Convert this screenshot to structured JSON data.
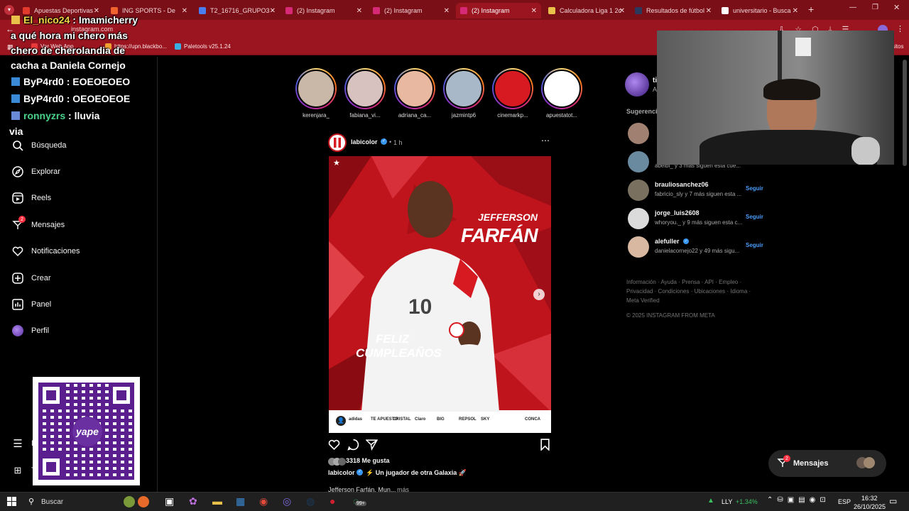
{
  "browser": {
    "tabs": [
      {
        "label": "Apuestas Deportivas",
        "color": "#e23b2e"
      },
      {
        "label": "ING SPORTS - De",
        "color": "#f0622e"
      },
      {
        "label": "T2_16716_GRUPO3 -",
        "color": "#4a7ef0"
      },
      {
        "label": "(2) Instagram",
        "color": "#d62976"
      },
      {
        "label": "(2) Instagram",
        "color": "#d62976"
      },
      {
        "label": "(2) Instagram",
        "color": "#d62976"
      },
      {
        "label": "Calculadora Liga 1 2c",
        "color": "#e8c04a"
      },
      {
        "label": "Resultados de fútbol",
        "color": "#2b3a5c"
      },
      {
        "label": "universitario - Busca",
        "color": "#ffffff"
      }
    ],
    "url": "instagram.com",
    "bookmarks": [
      "Ver Web App",
      "https://upn.blackbo...",
      "Paletools v25.1.24",
      "sitos"
    ]
  },
  "chat": [
    {
      "user": "El_nico24",
      "user_color": "#f5d547",
      "message": "Imamicherry"
    },
    {
      "message": "a qué hora mi chero más"
    },
    {
      "message": "chero de cherolandia de"
    },
    {
      "message": "cacha a Daniela Cornejo"
    },
    {
      "user": "ByP4rd0",
      "user_color": "#ffffff",
      "message": "EOEOEOEO"
    },
    {
      "user": "ByP4rd0",
      "user_color": "#ffffff",
      "message": "OEOEOEOE"
    },
    {
      "user": "ronnyzrs",
      "user_color": "#4ad18a",
      "message": "lluvia"
    },
    {
      "message": "via"
    }
  ],
  "sidebar": {
    "items": [
      {
        "label": "Búsqueda",
        "icon": "search-icon"
      },
      {
        "label": "Explorar",
        "icon": "compass-icon"
      },
      {
        "label": "Reels",
        "icon": "reels-icon"
      },
      {
        "label": "Mensajes",
        "icon": "messenger-icon",
        "badge": "2"
      },
      {
        "label": "Notificaciones",
        "icon": "heart-icon"
      },
      {
        "label": "Crear",
        "icon": "plus-square-icon"
      },
      {
        "label": "Panel",
        "icon": "dashboard-icon"
      },
      {
        "label": "Perfil",
        "icon": "avatar-icon"
      }
    ],
    "more_label": "M",
    "threads_label": "T"
  },
  "stories": [
    {
      "name": "kerenjara_",
      "color": "#c9b7a8"
    },
    {
      "name": "fabiana_vi...",
      "color": "#d8c2c0"
    },
    {
      "name": "adriana_ca...",
      "color": "#e8b8a0"
    },
    {
      "name": "jazmintp6",
      "color": "#a8b8c8"
    },
    {
      "name": "cinemarkp...",
      "color": "#d71921"
    },
    {
      "name": "apuestatot...",
      "color": "#ffffff"
    }
  ],
  "post": {
    "username": "labicolor",
    "time": "1 h",
    "player_first": "JEFFERSON",
    "player_last": "FARFÁN",
    "greeting_1": "FELIZ",
    "greeting_2": "CUMPLEAÑOS",
    "jersey_number": "10",
    "sponsors": [
      "adidas",
      "TE APUESTO",
      "CRISTAL",
      "Claro",
      "BIG",
      "REPSOL",
      "SKY",
      "",
      "CONCA"
    ],
    "likes": "3318 Me gusta",
    "caption_user": "labicolor",
    "caption": "⚡ Un jugador de otra Galaxia 🚀",
    "caption_more_text": "Jefferson Farfán, Mun...",
    "more": "más"
  },
  "right": {
    "current_user_initial": "ti",
    "current_user_sub": "A",
    "suggestions_title": "Sugerencias",
    "suggestions": [
      {
        "username": "",
        "sub": "",
        "follow": "",
        "color": "#a08070"
      },
      {
        "username": "",
        "sub": "abelbi_ y 3 más siguen esta cue...",
        "follow": "Seguir",
        "color": "#6a8aa0"
      },
      {
        "username": "brauliosanchez06",
        "sub": "fabricio_sly y 7 más siguen esta ...",
        "follow": "Seguir",
        "color": "#7a7060"
      },
      {
        "username": "jorge_luis2608",
        "sub": "whoryou._ y 9 más siguen esta c...",
        "follow": "Seguir",
        "color": "#dbdbdb"
      },
      {
        "username": "alefuller",
        "sub": "danielacornejo22 y 49 más sigu...",
        "follow": "Seguir",
        "color": "#d8b8a0"
      }
    ],
    "footer_line1": "Información · Ayuda · Prensa · API · Empleo ·",
    "footer_line2": "Privacidad · Condiciones · Ubicaciones · Idioma ·",
    "footer_line3": "Meta Verified",
    "copyright": "© 2025 INSTAGRAM FROM META"
  },
  "messages_pill": {
    "label": "Mensajes",
    "badge": "2"
  },
  "qr": {
    "brand": "yape"
  },
  "taskbar": {
    "search_placeholder": "Buscar",
    "badge": "99+",
    "stock_ticker": "LLY",
    "stock_change": "+1.34%",
    "language": "ESP",
    "time": "16:32",
    "date": "26/10/2025"
  },
  "colors": {
    "chrome_red": "#9a1520",
    "ig_blue": "#4a9eff",
    "post_red": "#c0141c"
  }
}
